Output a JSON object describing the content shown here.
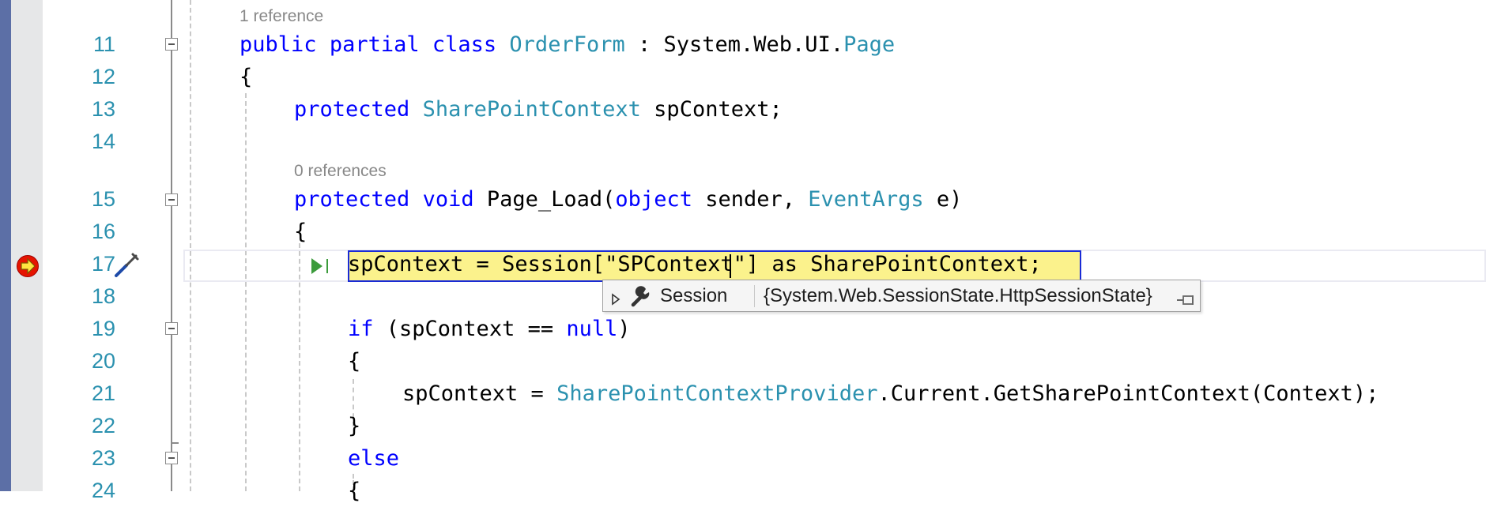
{
  "editor": {
    "lens_line10": "1 reference",
    "lens_line15": "0 references",
    "lines": [
      {
        "num": "11",
        "parts": [
          {
            "c": "kw",
            "t": "public"
          },
          {
            "c": "",
            "t": " "
          },
          {
            "c": "kw",
            "t": "partial"
          },
          {
            "c": "",
            "t": " "
          },
          {
            "c": "kw",
            "t": "class"
          },
          {
            "c": "",
            "t": " "
          },
          {
            "c": "ty",
            "t": "OrderForm"
          },
          {
            "c": "",
            "t": " : System.Web.UI."
          },
          {
            "c": "ty",
            "t": "Page"
          }
        ]
      },
      {
        "num": "12",
        "parts": [
          {
            "c": "",
            "t": "{"
          }
        ]
      },
      {
        "num": "13",
        "parts": [
          {
            "c": "kw",
            "t": "protected"
          },
          {
            "c": "",
            "t": " "
          },
          {
            "c": "ty",
            "t": "SharePointContext"
          },
          {
            "c": "",
            "t": " spContext;"
          }
        ]
      },
      {
        "num": "14",
        "parts": []
      },
      {
        "num": "15",
        "parts": [
          {
            "c": "kw",
            "t": "protected"
          },
          {
            "c": "",
            "t": " "
          },
          {
            "c": "kw",
            "t": "void"
          },
          {
            "c": "",
            "t": " Page_Load("
          },
          {
            "c": "kw",
            "t": "object"
          },
          {
            "c": "",
            "t": " sender, "
          },
          {
            "c": "ty",
            "t": "EventArgs"
          },
          {
            "c": "",
            "t": " e)"
          }
        ]
      },
      {
        "num": "16",
        "parts": [
          {
            "c": "",
            "t": "{"
          }
        ]
      },
      {
        "num": "17",
        "parts": [
          {
            "c": "",
            "t": "spContext = Session[\"SPContext\"] as SharePointContext;"
          }
        ]
      },
      {
        "num": "18",
        "parts": []
      },
      {
        "num": "19",
        "parts": [
          {
            "c": "kw",
            "t": "if"
          },
          {
            "c": "",
            "t": " (spContext == "
          },
          {
            "c": "kw",
            "t": "null"
          },
          {
            "c": "",
            "t": ")"
          }
        ]
      },
      {
        "num": "20",
        "parts": [
          {
            "c": "",
            "t": "{"
          }
        ]
      },
      {
        "num": "21",
        "parts": [
          {
            "c": "",
            "t": "spContext = "
          },
          {
            "c": "ty",
            "t": "SharePointContextProvider"
          },
          {
            "c": "",
            "t": ".Current.GetSharePointContext(Context);"
          }
        ]
      },
      {
        "num": "22",
        "parts": [
          {
            "c": "",
            "t": "}"
          }
        ]
      },
      {
        "num": "23",
        "parts": [
          {
            "c": "kw",
            "t": "else"
          }
        ]
      },
      {
        "num": "24",
        "parts": [
          {
            "c": "",
            "t": "{"
          }
        ]
      }
    ]
  },
  "datatip": {
    "name": "Session",
    "value": "{System.Web.SessionState.HttpSessionState}"
  },
  "icons": {
    "breakpoint": "current-statement-breakpoint-icon",
    "quick_action": "screwdriver-brush-icon",
    "run_to_click": "run-to-click-icon",
    "expand": "expand-triangle-icon",
    "property": "wrench-icon",
    "pin": "pin-icon"
  },
  "colors": {
    "keyword": "#0000ff",
    "type": "#2b91af",
    "line_number": "#2b91af",
    "highlight_bg": "#fbf28c",
    "highlight_border": "#1a2bd6",
    "margin_bar": "#5c6fa6"
  }
}
